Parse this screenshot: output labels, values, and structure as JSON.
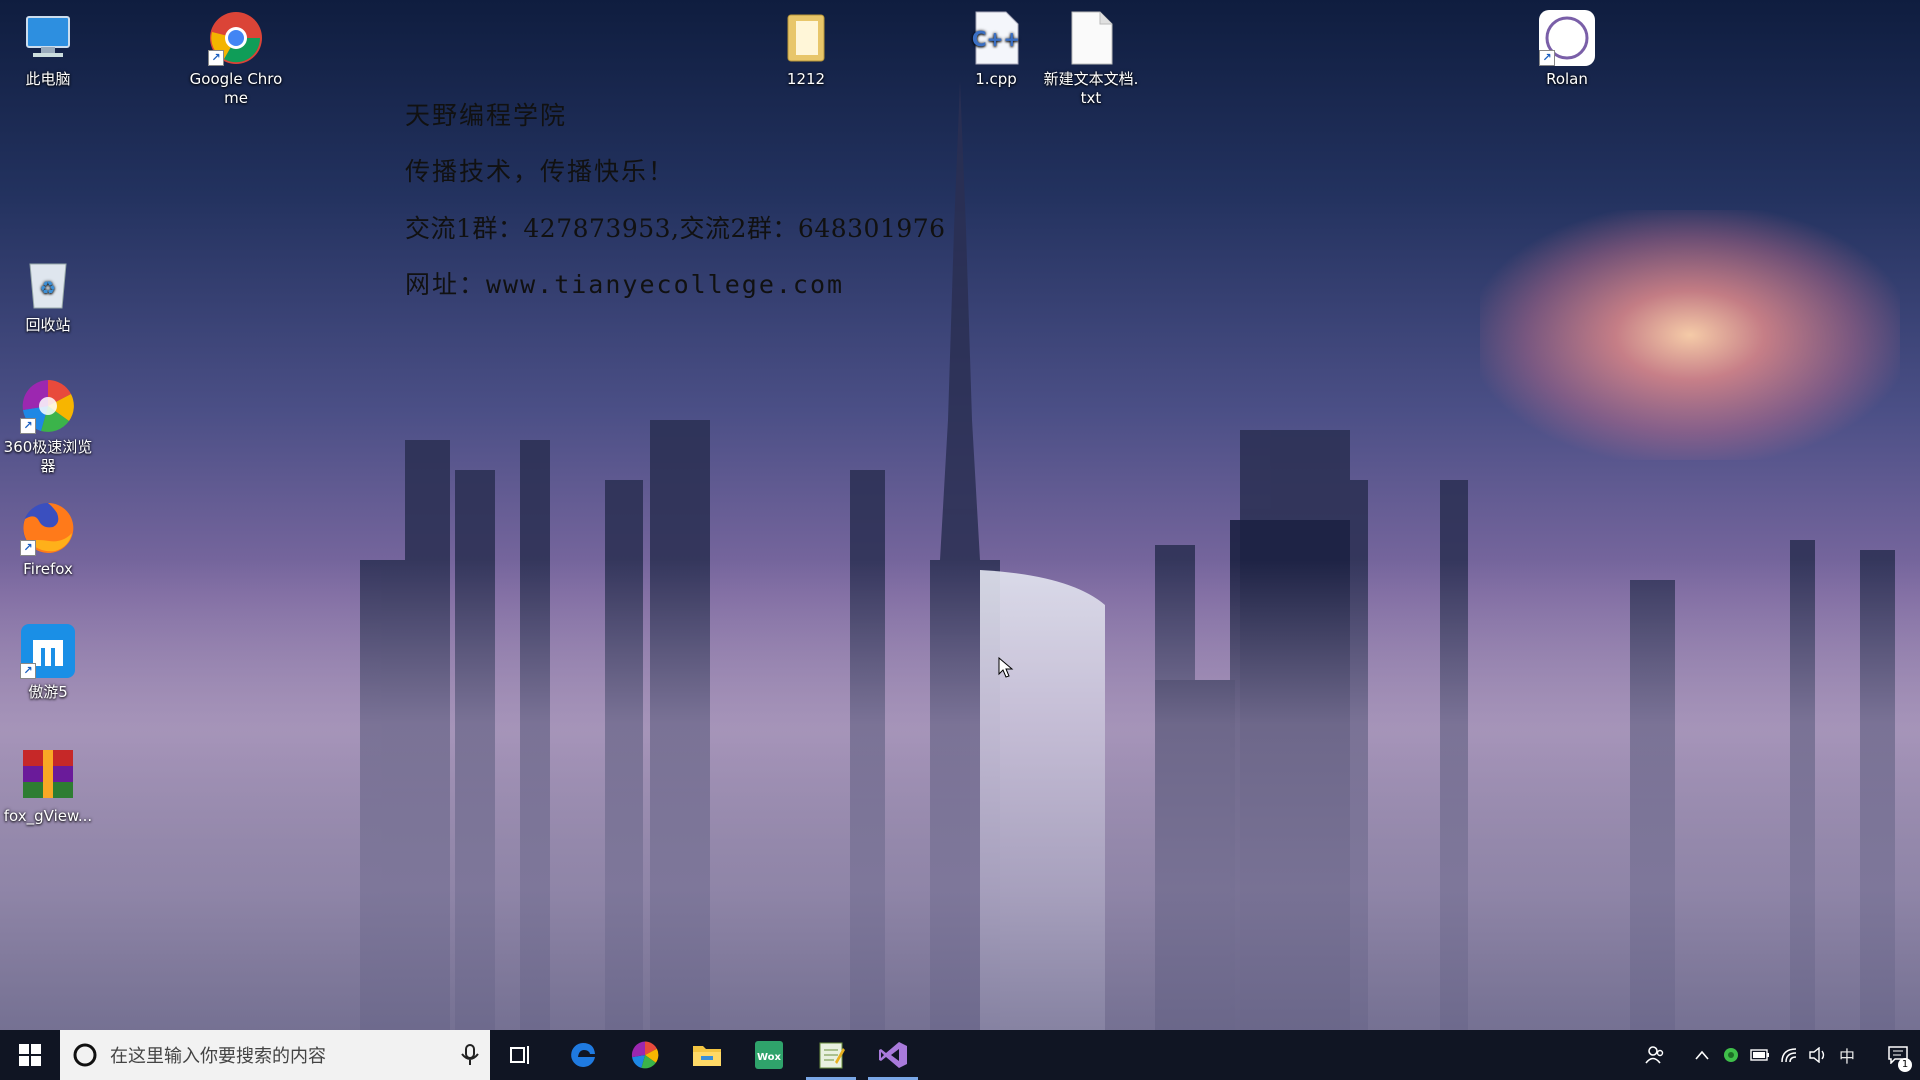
{
  "desktop": {
    "icons": [
      {
        "label": "此电脑",
        "icon": "computer-icon"
      },
      {
        "label": "Google Chrome",
        "icon": "chrome-icon"
      },
      {
        "label": "1212",
        "icon": "folder-icon"
      },
      {
        "label": "1.cpp",
        "icon": "cpp-file-icon"
      },
      {
        "label": "新建文本文档.txt",
        "icon": "text-file-icon"
      },
      {
        "label": "Rolan",
        "icon": "rolan-icon"
      },
      {
        "label": "回收站",
        "icon": "recycle-bin-icon"
      },
      {
        "label": "360极速浏览器",
        "icon": "360-browser-icon"
      },
      {
        "label": "Firefox",
        "icon": "firefox-icon"
      },
      {
        "label": "傲游5",
        "icon": "maxthon-icon"
      },
      {
        "label": "fox_gView...",
        "icon": "winrar-icon"
      }
    ]
  },
  "overlay": {
    "line1": "天野编程学院",
    "line2": "传播技术，传播快乐！",
    "line3": "交流1群：427873953,交流2群：648301976",
    "line4": "网址：www.tianyecollege.com"
  },
  "taskbar": {
    "search_placeholder": "在这里输入你要搜索的内容",
    "ime_label": "中",
    "notification_count": "1",
    "apps": [
      {
        "icon": "task-view-icon"
      },
      {
        "icon": "edge-icon"
      },
      {
        "icon": "360-browser-icon"
      },
      {
        "icon": "file-explorer-icon"
      },
      {
        "icon": "wox-icon",
        "label": "Wox"
      },
      {
        "icon": "notepad-icon"
      },
      {
        "icon": "visual-studio-icon"
      }
    ]
  },
  "colors": {
    "taskbar_bg": "#101523",
    "search_bg": "#f2f2f2",
    "active_indicator": "#7aa7e6"
  }
}
